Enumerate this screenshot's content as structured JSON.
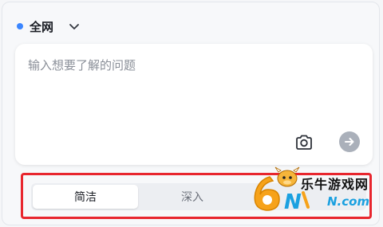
{
  "scope": {
    "label": "全网"
  },
  "input": {
    "placeholder": "输入想要了解的问题",
    "value": ""
  },
  "icons": {
    "scope_dot": "dot-icon",
    "chevron": "chevron-down-icon",
    "camera": "camera-icon",
    "send": "arrow-right-icon"
  },
  "mode_tabs": [
    {
      "label": "简洁",
      "active": true
    },
    {
      "label": "深入",
      "active": false
    }
  ],
  "watermark": {
    "number": "6",
    "text_cn": "乐牛游戏网",
    "text_en": "N.com"
  },
  "colors": {
    "accent_dot": "#3b86ff",
    "highlight_border": "#e8262e",
    "send_button": "#aab0ba",
    "watermark_orange": "#f6a21a",
    "watermark_blue": "#1aa0e0"
  }
}
